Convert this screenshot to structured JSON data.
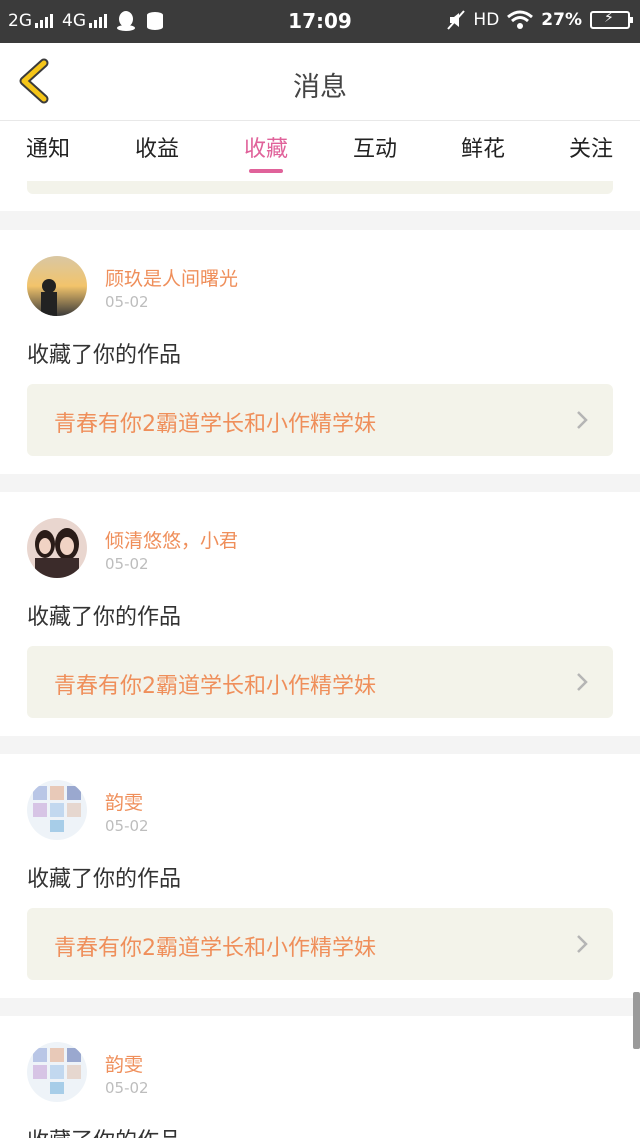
{
  "status_bar": {
    "network1": "2G",
    "network2": "4G",
    "time": "17:09",
    "hd": "HD",
    "battery": "27%",
    "icons": [
      "signal-icon",
      "qq-icon",
      "data-icon",
      "mute-icon",
      "wifi-icon",
      "battery-icon"
    ]
  },
  "header": {
    "title": "消息",
    "back_icon": "chevron-left-icon",
    "accent": "#f5c518"
  },
  "tabs": [
    {
      "label": "通知"
    },
    {
      "label": "收益"
    },
    {
      "label": "收藏",
      "active": true
    },
    {
      "label": "互动"
    },
    {
      "label": "鲜花"
    },
    {
      "label": "关注"
    }
  ],
  "colors": {
    "active_tab": "#e0629a",
    "username": "#ef8f5b",
    "work_title": "#ef8f5b",
    "work_bg": "#f3f3ea"
  },
  "items": [
    {
      "username": "顾玖是人间曙光",
      "date": "05-02",
      "action": "收藏了你的作品",
      "work_title": "青春有你2霸道学长和小作精学妹"
    },
    {
      "username": "倾清悠悠，小君",
      "date": "05-02",
      "action": "收藏了你的作品",
      "work_title": "青春有你2霸道学长和小作精学妹"
    },
    {
      "username": "韵雯",
      "date": "05-02",
      "action": "收藏了你的作品",
      "work_title": "青春有你2霸道学长和小作精学妹"
    },
    {
      "username": "韵雯",
      "date": "05-02",
      "action": "收藏了你的作品"
    }
  ]
}
